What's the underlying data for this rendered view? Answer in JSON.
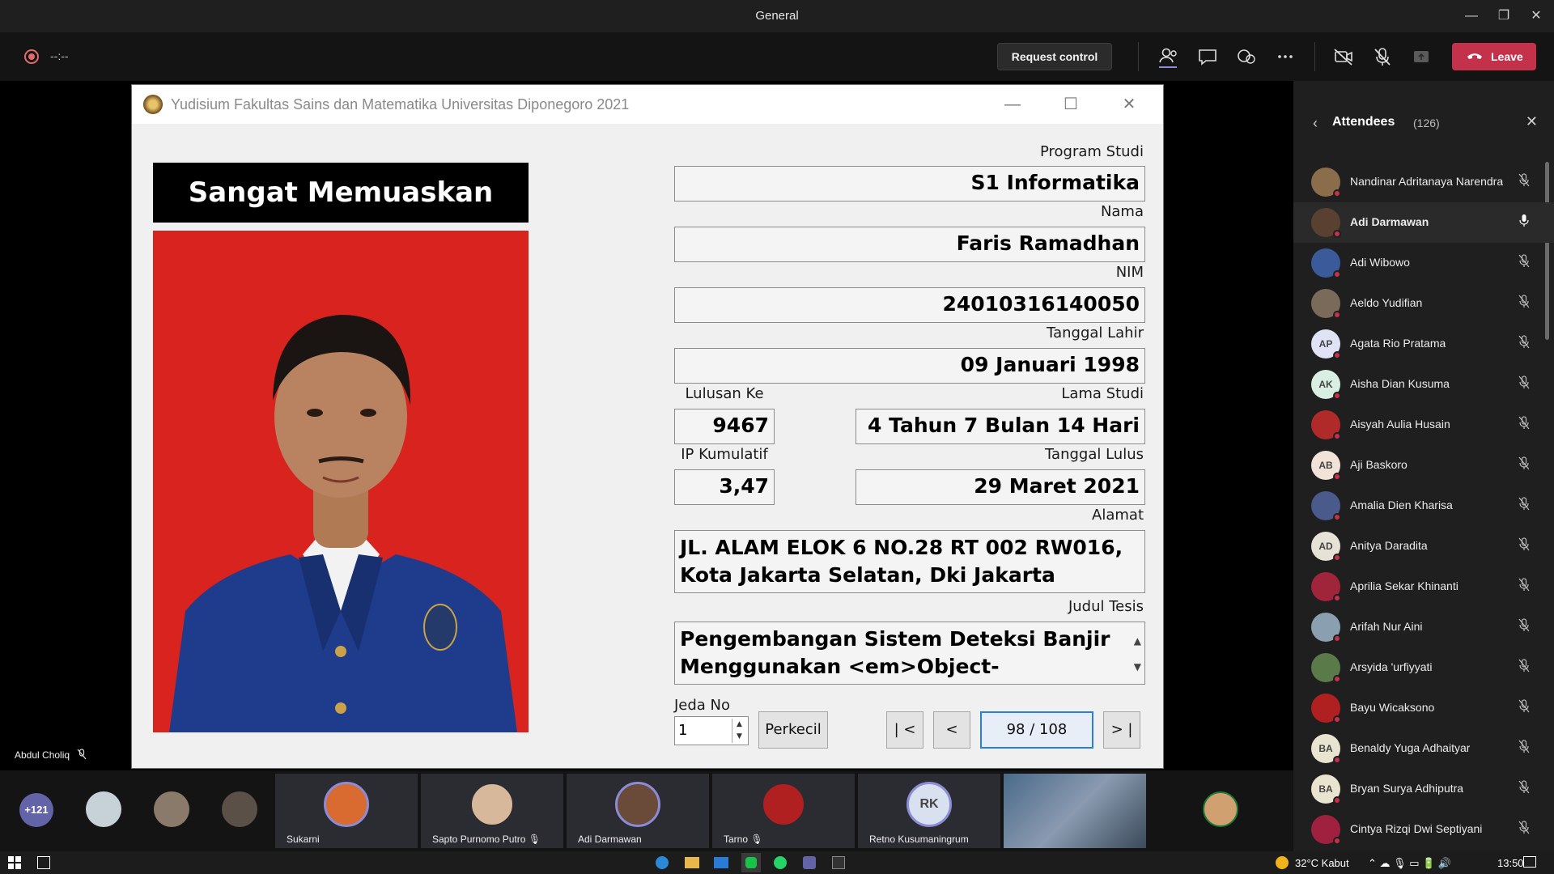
{
  "window": {
    "title": "General",
    "minimize": "—",
    "restore": "❐",
    "close": "✕"
  },
  "toolbar": {
    "timer": "--:--",
    "request_control": "Request control",
    "leave": "Leave"
  },
  "app": {
    "title": "Yudisium Fakultas Sains dan Matematika Universitas Diponegoro 2021",
    "predicate": "Sangat Memuaskan",
    "labels": {
      "program": "Program Studi",
      "name": "Nama",
      "nim": "NIM",
      "birth": "Tanggal Lahir",
      "graduate_no": "Lulusan Ke",
      "study_length": "Lama Studi",
      "gpa": "IP Kumulatif",
      "grad_date": "Tanggal Lulus",
      "address": "Alamat",
      "thesis": "Judul Tesis",
      "jeda": "Jeda No"
    },
    "values": {
      "program": "S1 Informatika",
      "name": "Faris Ramadhan",
      "nim": "24010316140050",
      "birth": "09 Januari 1998",
      "graduate_no": "9467",
      "study_length": "4 Tahun 7 Bulan 14 Hari",
      "gpa": "3,47",
      "grad_date": "29 Maret 2021",
      "address": "JL. ALAM ELOK 6 NO.28 RT 002 RW016, Kota Jakarta Selatan, Dki Jakarta",
      "thesis": "Pengembangan Sistem Deteksi Banjir Menggunakan <em>Object-Oriented<br>",
      "jeda": "1"
    },
    "buttons": {
      "shrink": "Perkecil",
      "first": "| <",
      "prev": "<",
      "page": "98 / 108",
      "last": "> |"
    }
  },
  "stage": {
    "presenter_name": "Abdul Choliq"
  },
  "attendees": {
    "title": "Attendees",
    "count": "(126)",
    "list": [
      {
        "name": "Nandinar Adritanaya Narendra",
        "initials": "",
        "color": "#8a6d4a",
        "muted": true
      },
      {
        "name": "Adi Darmawan",
        "initials": "",
        "color": "#5a4030",
        "muted": false,
        "active": true
      },
      {
        "name": "Adi Wibowo",
        "initials": "",
        "color": "#3a5a9a",
        "muted": true
      },
      {
        "name": "Aeldo Yudifian",
        "initials": "",
        "color": "#7a6a5a",
        "muted": true
      },
      {
        "name": "Agata Rio Pratama",
        "initials": "AP",
        "color": "#dfe3f5",
        "muted": true
      },
      {
        "name": "Aisha Dian Kusuma",
        "initials": "AK",
        "color": "#d9efe3",
        "muted": true
      },
      {
        "name": "Aisyah Aulia Husain",
        "initials": "",
        "color": "#b02a2a",
        "muted": true
      },
      {
        "name": "Aji Baskoro",
        "initials": "AB",
        "color": "#f2e3d8",
        "muted": true
      },
      {
        "name": "Amalia Dien Kharisa",
        "initials": "",
        "color": "#4a5a8a",
        "muted": true
      },
      {
        "name": "Anitya Daradita",
        "initials": "AD",
        "color": "#e7e2d6",
        "muted": true
      },
      {
        "name": "Aprilia Sekar Khinanti",
        "initials": "",
        "color": "#a0243a",
        "muted": true
      },
      {
        "name": "Arifah Nur Aini",
        "initials": "",
        "color": "#8aa0b0",
        "muted": true
      },
      {
        "name": "Arsyida 'urfiyyati",
        "initials": "",
        "color": "#5a7a4a",
        "muted": true
      },
      {
        "name": "Bayu Wicaksono",
        "initials": "",
        "color": "#b02020",
        "muted": true
      },
      {
        "name": "Benaldy Yuga Adhaityar",
        "initials": "BA",
        "color": "#e9e4d0",
        "muted": true
      },
      {
        "name": "Bryan Surya Adhiputra",
        "initials": "BA",
        "color": "#e9e4d0",
        "muted": true
      },
      {
        "name": "Cintya Rizqi Dwi Septiyani",
        "initials": "",
        "color": "#a02040",
        "muted": true
      }
    ]
  },
  "gallery": {
    "overflow": "+121",
    "tiles": [
      {
        "name": "Sukarni",
        "muted": false
      },
      {
        "name": "Sapto Purnomo Putro",
        "muted": true
      },
      {
        "name": "Adi Darmawan",
        "muted": false
      },
      {
        "name": "Tarno",
        "muted": true
      },
      {
        "name": "Retno Kusumaningrum",
        "initials": "RK",
        "muted": false
      }
    ]
  },
  "taskbar": {
    "weather": "32°C  Kabut",
    "time": "13:50"
  }
}
